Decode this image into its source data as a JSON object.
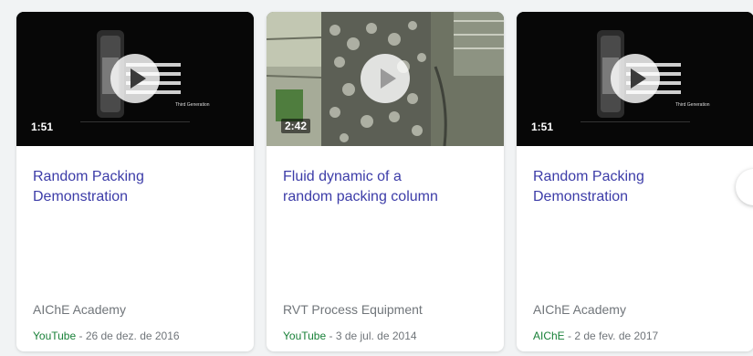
{
  "cards": [
    {
      "duration": "1:51",
      "thumb_caption": "Third Generation",
      "title_line1": "Random Packing",
      "title_line2": "Demonstration",
      "source": "AIChE Academy",
      "site": "YouTube",
      "date": " - 26 de dez. de 2016"
    },
    {
      "duration": "2:42",
      "title_line1": "Fluid dynamic of a",
      "title_line2": "random packing column",
      "source": "RVT Process Equipment",
      "site": "YouTube",
      "date": " - 3 de jul. de 2014"
    },
    {
      "duration": "1:51",
      "thumb_caption": "Third Generation",
      "title_line1": "Random Packing",
      "title_line2": "Demonstration",
      "source": "AIChE Academy",
      "site": "AIChE",
      "date": " - 2 de fev. de 2017"
    }
  ],
  "icons": {
    "play": "play-icon",
    "next": "chevron-right-icon"
  },
  "colors": {
    "title": "#3c3ca8",
    "site": "#188038",
    "meta": "#70757a"
  }
}
